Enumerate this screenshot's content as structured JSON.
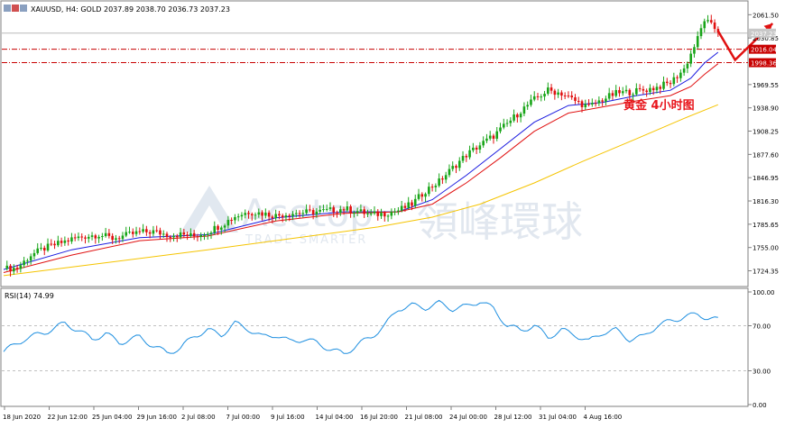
{
  "header": {
    "symbol_line": "XAUUSD, H4:  GOLD  2037.89 2038.70 2036.73 2037.23"
  },
  "annotation": {
    "text": "黄金  4小时图",
    "color": "#e8141b"
  },
  "watermark": {
    "brand": "Acetop",
    "chinese": "領峰環球",
    "tagline": "TRADE SMARTER",
    "color": "#c9d5e3"
  },
  "colors": {
    "bull": "#18a518",
    "bear": "#e01010",
    "ma_fast": "#1a1adf",
    "ma_mid": "#e01010",
    "ma_slow": "#f5c400",
    "rsi_line": "#1e8fe0",
    "level_line": "#c80000",
    "arrow": "#e01010"
  },
  "chart_data": [
    {
      "type": "candlestick",
      "title": "XAUUSD, H4:  GOLD  2037.89 2038.70 2036.73 2037.23",
      "ylim": [
        1706,
        2069
      ],
      "y_ticks": [
        "2061.50",
        "2030.85",
        "1969.55",
        "1938.90",
        "1908.25",
        "1877.60",
        "1846.95",
        "1816.30",
        "1785.65",
        "1755.00",
        "1724.35"
      ],
      "price_labels": [
        {
          "label": "2037.23",
          "value": 2037.23,
          "style": "current"
        },
        {
          "label": "2016.04",
          "value": 2016.04,
          "style": "level"
        },
        {
          "label": "1998.36",
          "value": 1998.36,
          "style": "level"
        }
      ],
      "levels": [
        2016.04,
        1998.36
      ],
      "x_labels": [
        "18 Jun 2020",
        "22 Jun 12:00",
        "25 Jun 04:00",
        "29 Jun 16:00",
        "2 Jul 08:00",
        "7 Jul 00:00",
        "9 Jul 16:00",
        "14 Jul 04:00",
        "16 Jul 20:00",
        "21 Jul 08:00",
        "24 Jul 00:00",
        "28 Jul 12:00",
        "31 Jul 04:00",
        "4 Aug 16:00"
      ],
      "close_path": [
        [
          0,
          1727
        ],
        [
          4,
          1728
        ],
        [
          8,
          1745
        ],
        [
          12,
          1754
        ],
        [
          16,
          1760
        ],
        [
          20,
          1766
        ],
        [
          24,
          1770
        ],
        [
          28,
          1772
        ],
        [
          32,
          1767
        ],
        [
          36,
          1771
        ],
        [
          40,
          1775
        ],
        [
          44,
          1776
        ],
        [
          48,
          1772
        ],
        [
          52,
          1772
        ],
        [
          56,
          1770
        ],
        [
          60,
          1776
        ],
        [
          64,
          1785
        ],
        [
          68,
          1796
        ],
        [
          72,
          1802
        ],
        [
          76,
          1800
        ],
        [
          80,
          1797
        ],
        [
          84,
          1800
        ],
        [
          88,
          1801
        ],
        [
          92,
          1802
        ],
        [
          96,
          1804
        ],
        [
          100,
          1806
        ],
        [
          104,
          1803
        ],
        [
          108,
          1798
        ],
        [
          112,
          1800
        ],
        [
          116,
          1804
        ],
        [
          120,
          1812
        ],
        [
          124,
          1830
        ],
        [
          128,
          1842
        ],
        [
          132,
          1860
        ],
        [
          136,
          1877
        ],
        [
          140,
          1890
        ],
        [
          144,
          1902
        ],
        [
          148,
          1918
        ],
        [
          152,
          1935
        ],
        [
          156,
          1950
        ],
        [
          160,
          1962
        ],
        [
          164,
          1958
        ],
        [
          168,
          1948
        ],
        [
          172,
          1940
        ],
        [
          176,
          1950
        ],
        [
          180,
          1958
        ],
        [
          184,
          1960
        ],
        [
          188,
          1962
        ],
        [
          192,
          1966
        ],
        [
          196,
          1972
        ],
        [
          200,
          1990
        ],
        [
          204,
          2030
        ],
        [
          206,
          2055
        ],
        [
          208,
          2047
        ],
        [
          210,
          2040
        ]
      ],
      "forecast_arrow": [
        [
          2040,
          210
        ],
        [
          2002,
          215
        ],
        [
          2050,
          226
        ]
      ],
      "moving_averages": [
        {
          "color": "#1a1adf",
          "points": [
            [
              0,
              1726
            ],
            [
              20,
              1752
            ],
            [
              40,
              1768
            ],
            [
              60,
              1772
            ],
            [
              80,
              1794
            ],
            [
              100,
              1802
            ],
            [
              116,
              1802
            ],
            [
              126,
              1818
            ],
            [
              136,
              1850
            ],
            [
              146,
              1885
            ],
            [
              156,
              1920
            ],
            [
              166,
              1942
            ],
            [
              176,
              1946
            ],
            [
              186,
              1955
            ],
            [
              196,
              1962
            ],
            [
              202,
              1978
            ],
            [
              206,
              1998
            ],
            [
              210,
              2012
            ]
          ]
        },
        {
          "color": "#e01010",
          "points": [
            [
              0,
              1722
            ],
            [
              20,
              1745
            ],
            [
              40,
              1764
            ],
            [
              60,
              1770
            ],
            [
              80,
              1790
            ],
            [
              100,
              1800
            ],
            [
              116,
              1802
            ],
            [
              126,
              1812
            ],
            [
              136,
              1840
            ],
            [
              146,
              1873
            ],
            [
              156,
              1908
            ],
            [
              166,
              1932
            ],
            [
              176,
              1940
            ],
            [
              186,
              1948
            ],
            [
              196,
              1955
            ],
            [
              202,
              1967
            ],
            [
              206,
              1983
            ],
            [
              210,
              1997
            ]
          ]
        },
        {
          "color": "#f5c400",
          "points": [
            [
              0,
              1718
            ],
            [
              30,
              1735
            ],
            [
              60,
              1752
            ],
            [
              90,
              1770
            ],
            [
              110,
              1782
            ],
            [
              126,
              1795
            ],
            [
              140,
              1812
            ],
            [
              156,
              1840
            ],
            [
              170,
              1868
            ],
            [
              186,
              1898
            ],
            [
              200,
              1925
            ],
            [
              210,
              1943
            ]
          ]
        }
      ]
    },
    {
      "type": "line",
      "title": "RSI(14) 74.99",
      "ylim": [
        0,
        100
      ],
      "y_ticks": [
        "100.00",
        "70.00",
        "30.00",
        "0.00"
      ],
      "guide_levels": [
        70,
        30
      ],
      "points": [
        [
          0,
          47
        ],
        [
          6,
          58
        ],
        [
          12,
          64
        ],
        [
          18,
          72
        ],
        [
          22,
          66
        ],
        [
          26,
          58
        ],
        [
          30,
          63
        ],
        [
          34,
          55
        ],
        [
          40,
          60
        ],
        [
          44,
          52
        ],
        [
          48,
          46
        ],
        [
          52,
          50
        ],
        [
          56,
          61
        ],
        [
          60,
          66
        ],
        [
          64,
          62
        ],
        [
          68,
          72
        ],
        [
          72,
          67
        ],
        [
          76,
          60
        ],
        [
          80,
          62
        ],
        [
          84,
          56
        ],
        [
          88,
          58
        ],
        [
          92,
          55
        ],
        [
          96,
          49
        ],
        [
          100,
          45
        ],
        [
          104,
          53
        ],
        [
          108,
          60
        ],
        [
          112,
          70
        ],
        [
          116,
          85
        ],
        [
          120,
          88
        ],
        [
          124,
          86
        ],
        [
          128,
          90
        ],
        [
          132,
          85
        ],
        [
          136,
          87
        ],
        [
          140,
          92
        ],
        [
          144,
          85
        ],
        [
          148,
          70
        ],
        [
          152,
          66
        ],
        [
          156,
          70
        ],
        [
          160,
          60
        ],
        [
          164,
          66
        ],
        [
          168,
          62
        ],
        [
          172,
          56
        ],
        [
          176,
          64
        ],
        [
          180,
          66
        ],
        [
          184,
          58
        ],
        [
          188,
          60
        ],
        [
          192,
          70
        ],
        [
          196,
          74
        ],
        [
          200,
          78
        ],
        [
          204,
          80
        ],
        [
          207,
          77
        ],
        [
          210,
          75
        ]
      ]
    }
  ]
}
